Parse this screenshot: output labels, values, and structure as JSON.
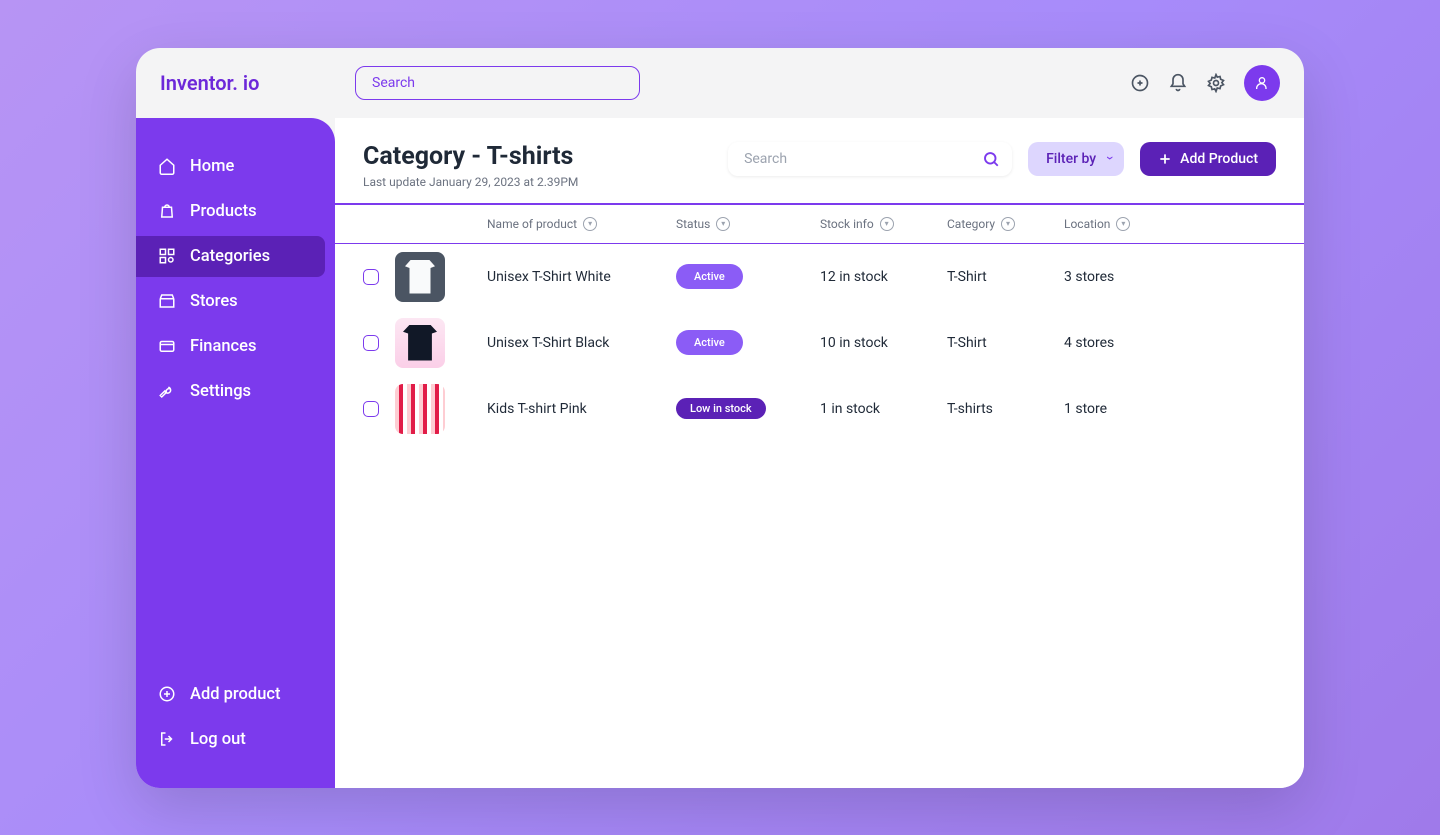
{
  "brand": "Inventor. io",
  "search_top_placeholder": "Search",
  "sidebar": {
    "items": [
      {
        "label": "Home"
      },
      {
        "label": "Products"
      },
      {
        "label": "Categories"
      },
      {
        "label": "Stores"
      },
      {
        "label": "Finances"
      },
      {
        "label": "Settings"
      }
    ],
    "bottom": [
      {
        "label": "Add product"
      },
      {
        "label": "Log out"
      }
    ]
  },
  "page": {
    "title": "Category - T-shirts",
    "subtitle": "Last update January 29, 2023 at 2.39PM",
    "search_placeholder": "Search",
    "filter_label": "Filter by",
    "add_label": "Add Product"
  },
  "columns": {
    "name": "Name of product",
    "status": "Status",
    "stock": "Stock info",
    "category": "Category",
    "location": "Location"
  },
  "rows": [
    {
      "name": "Unisex T-Shirt White",
      "status": "Active",
      "status_type": "active",
      "stock": "12 in stock",
      "category": "T-Shirt",
      "location": "3 stores",
      "thumb": "white"
    },
    {
      "name": "Unisex T-Shirt Black",
      "status": "Active",
      "status_type": "active",
      "stock": "10 in stock",
      "category": "T-Shirt",
      "location": "4 stores",
      "thumb": "black"
    },
    {
      "name": "Kids T-shirt Pink",
      "status": "Low in stock",
      "status_type": "low",
      "stock": "1 in stock",
      "category": "T-shirts",
      "location": "1 store",
      "thumb": "pink"
    }
  ]
}
